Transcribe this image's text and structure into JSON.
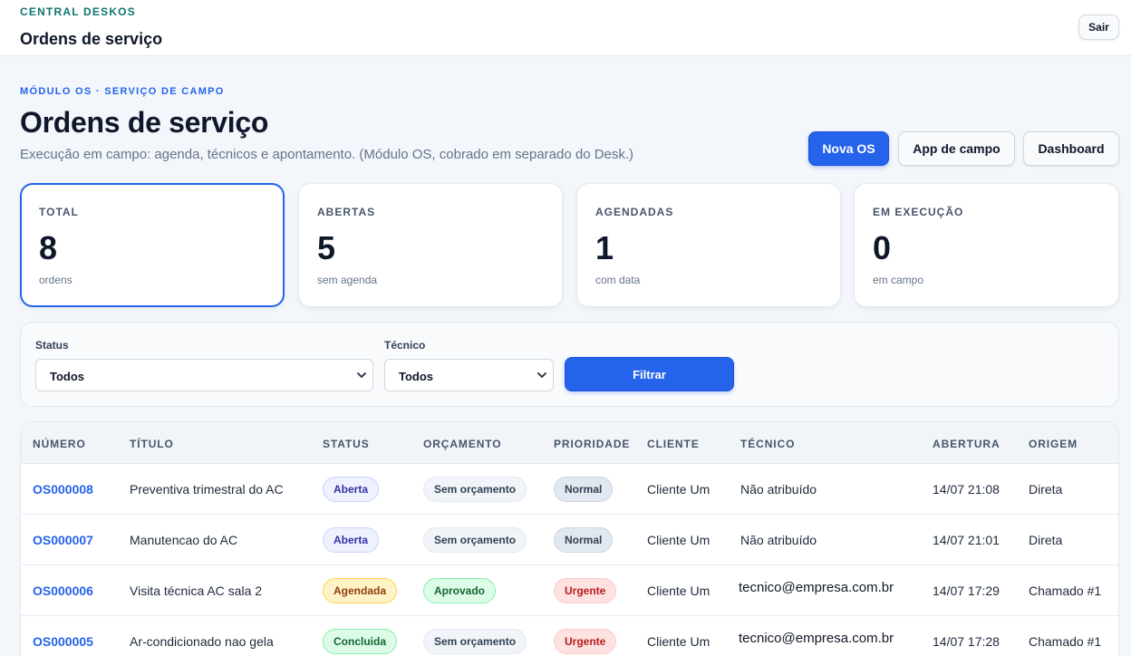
{
  "topbar": {
    "brand": "CENTRAL DESKOS",
    "title": "Ordens de serviço",
    "logout_label": "Sair"
  },
  "header": {
    "eyebrow": "MÓDULO OS · SERVIÇO DE CAMPO",
    "title": "Ordens de serviço",
    "subtitle": "Execução em campo: agenda, técnicos e apontamento. (Módulo OS, cobrado em separado do Desk.)",
    "buttons": {
      "new_os": "Nova OS",
      "field_app": "App de campo",
      "dashboard": "Dashboard"
    }
  },
  "stats": [
    {
      "label": "TOTAL",
      "value": "8",
      "sub": "ordens"
    },
    {
      "label": "ABERTAS",
      "value": "5",
      "sub": "sem agenda"
    },
    {
      "label": "AGENDADAS",
      "value": "1",
      "sub": "com data"
    },
    {
      "label": "EM EXECUÇÃO",
      "value": "0",
      "sub": "em campo"
    }
  ],
  "filters": {
    "status_label": "Status",
    "status_value": "Todos",
    "tech_label": "Técnico",
    "tech_value": "Todos",
    "filter_label": "Filtrar"
  },
  "table": {
    "headers": {
      "number": "NÚMERO",
      "title": "TÍTULO",
      "status": "STATUS",
      "budget": "ORÇAMENTO",
      "priority": "PRIORIDADE",
      "client": "CLIENTE",
      "tech": "TÉCNICO",
      "opened": "ABERTURA",
      "origin": "ORIGEM"
    },
    "rows": [
      {
        "number": "OS000008",
        "title": "Preventiva trimestral do AC",
        "status": "Aberta",
        "budget": "Sem orçamento",
        "priority": "Normal",
        "client": "Cliente Um",
        "tech": "Não atribuído",
        "opened": "14/07 21:08",
        "origin": "Direta"
      },
      {
        "number": "OS000007",
        "title": "Manutencao do AC",
        "status": "Aberta",
        "budget": "Sem orçamento",
        "priority": "Normal",
        "client": "Cliente Um",
        "tech": "Não atribuído",
        "opened": "14/07 21:01",
        "origin": "Direta"
      },
      {
        "number": "OS000006",
        "title": "Visita técnica AC sala 2",
        "status": "Agendada",
        "budget": "Aprovado",
        "priority": "Urgente",
        "client": "Cliente Um",
        "tech": "tecnico@empresa.com.br",
        "opened": "14/07 17:29",
        "origin": "Chamado #1"
      },
      {
        "number": "OS000005",
        "title": "Ar-condicionado nao gela",
        "status": "Concluida",
        "budget": "Sem orçamento",
        "priority": "Urgente",
        "client": "Cliente Um",
        "tech": "tecnico@empresa.com.br",
        "opened": "14/07 17:28",
        "origin": "Chamado #1"
      }
    ]
  }
}
